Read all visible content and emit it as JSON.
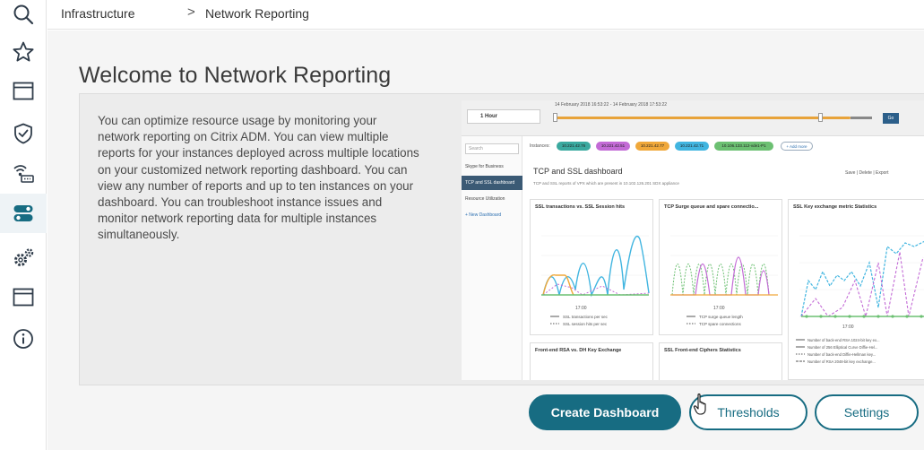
{
  "breadcrumb": {
    "root": "Infrastructure",
    "separator": ">",
    "current": "Network Reporting"
  },
  "sidebar": {
    "items": [
      {
        "icon": "search-icon"
      },
      {
        "icon": "star-icon"
      },
      {
        "icon": "window-icon"
      },
      {
        "icon": "shield-check-icon"
      },
      {
        "icon": "network-icon"
      },
      {
        "icon": "toggle-icon",
        "active": true
      },
      {
        "icon": "gears-icon"
      },
      {
        "icon": "window-icon"
      },
      {
        "icon": "info-icon"
      }
    ]
  },
  "main": {
    "title": "Welcome to Network Reporting",
    "description": "You can optimize resource usage by monitoring your network reporting on Citrix ADM. You can view multiple reports for your instances deployed across multiple locations on your customized network reporting dashboard. You can view any number of reports and up to ten instances on your dashboard. You can troubleshoot instance issues and monitor network reporting data for multiple instances simultaneously."
  },
  "preview": {
    "time_select": "1 Hour",
    "time_range": "14 February 2018 16:53:22 - 14 February 2018 17:53:22",
    "go_label": "Go",
    "search_placeholder": "Search",
    "nav": [
      "Skype for Business",
      "TCP and SSL dashboard",
      "Resource Utilization",
      "+ New Dashboard"
    ],
    "instances_label": "Instances:",
    "instances": [
      {
        "label": "10.221.42.76",
        "color": "#3aa99f"
      },
      {
        "label": "10.221.42.51",
        "color": "#c36bd6"
      },
      {
        "label": "10.221.42.77",
        "color": "#f0a83a"
      },
      {
        "label": "10.221.42.71",
        "color": "#41b5e0"
      },
      {
        "label": "10.106.133.112-vde1-P1",
        "color": "#6cc072"
      }
    ],
    "add_more": "+ Add more",
    "dashboard_title": "TCP and SSL dashboard",
    "dashboard_sub": "TCP and SSL reports of VPX which are present in 10.102.126.201 SDX appliance",
    "actions": "Save  |  Delete  |  Export",
    "cards": [
      {
        "title": "SSL transactions vs. SSL Session hits",
        "legend": [
          "SSL transactions per sec",
          "SSL session hits per sec"
        ]
      },
      {
        "title": "TCP Surge queue and spare connectio...",
        "legend": [
          "TCP surge queue length",
          "TCP spare connections"
        ]
      },
      {
        "title": "SSL Key exchange metric Statistics",
        "legend": [
          "Number of back-end RSA 1024-bit key ex...",
          "Number of 256 Elliptical Curve Diffie-Hel...",
          "Number of back-end Diffie-Hellman key...",
          "Number of RSA 2048-bit key exchange..."
        ]
      },
      {
        "title": "Front-end RSA vs. DH Key Exchange",
        "legend": []
      },
      {
        "title": "SSL Front-end Ciphers Statistics",
        "legend": []
      }
    ],
    "x_tick": "17:00"
  },
  "actions": {
    "create_label": "Create Dashboard",
    "thresholds_label": "Thresholds",
    "settings_label": "Settings"
  },
  "colors": {
    "primary": "#176c82",
    "sidebar_active": "#176c82"
  }
}
